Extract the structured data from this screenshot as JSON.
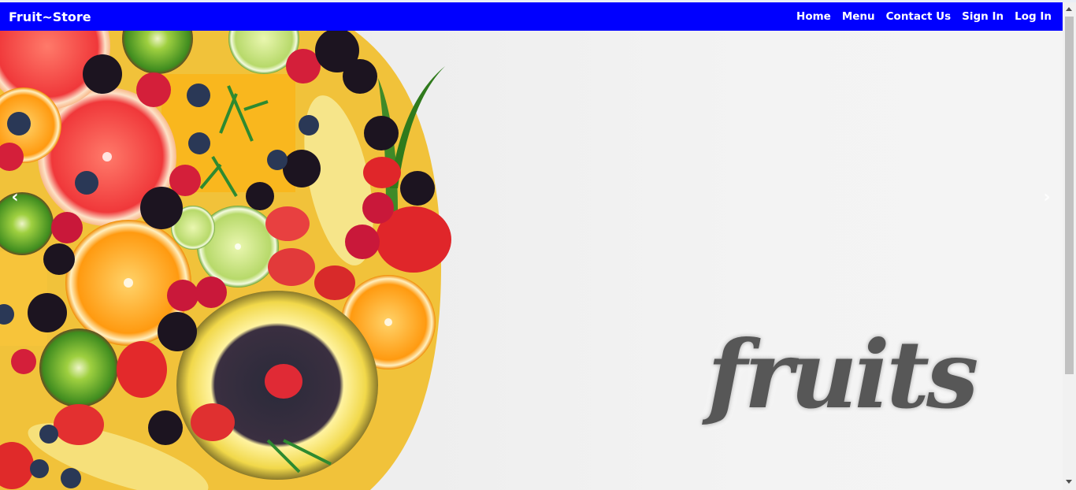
{
  "navbar": {
    "brand": "Fruit~Store",
    "background_color": "#0000ff",
    "links": [
      {
        "label": "Home"
      },
      {
        "label": "Menu"
      },
      {
        "label": "Contact Us"
      },
      {
        "label": "Sign In"
      },
      {
        "label": "Log In"
      }
    ]
  },
  "carousel": {
    "prev_glyph": "‹",
    "next_glyph": "›",
    "slide_caption": "fruits",
    "slide_image": "assorted-fruit-platter"
  }
}
